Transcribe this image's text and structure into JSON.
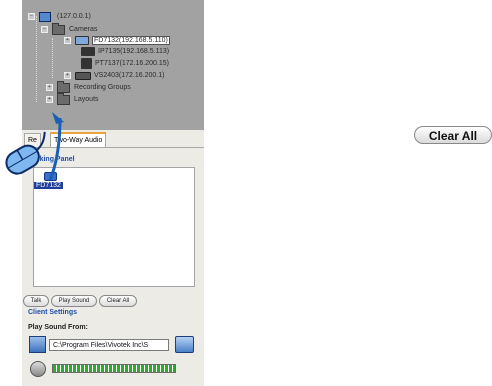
{
  "tree": {
    "root": "(127.0.0.1)",
    "cameras_folder": "Cameras",
    "cameras": [
      "FD7132(192.168.5.110)",
      "IP7135(192.168.5.113)",
      "PT7137(172.16.200.15)",
      "VS2403(172.16.200.1)"
    ],
    "recording_groups": "Recording Groups",
    "layouts": "Layouts"
  },
  "tabs": {
    "first": "Re",
    "two_way": "Two-Way Audio"
  },
  "talking_panel": {
    "label": "Talking Panel",
    "items": [
      "FD7132"
    ]
  },
  "buttons": {
    "talk": "Talk",
    "play_sound": "Play Sound",
    "clear_all": "Clear All"
  },
  "client_settings": {
    "label": "Client Settings",
    "play_sound_from": "Play Sound From:",
    "path_value": "C:\\Program Files\\Vivotek Inc\\S"
  },
  "standalone_button": {
    "label": "Clear All"
  },
  "colors": {
    "tree_bg": "#a2a2a2",
    "panel_bg": "#ecebe6",
    "link_blue": "#1e4ea8",
    "level_green": "#2eab2e",
    "tab_accent": "#e8a33c"
  }
}
